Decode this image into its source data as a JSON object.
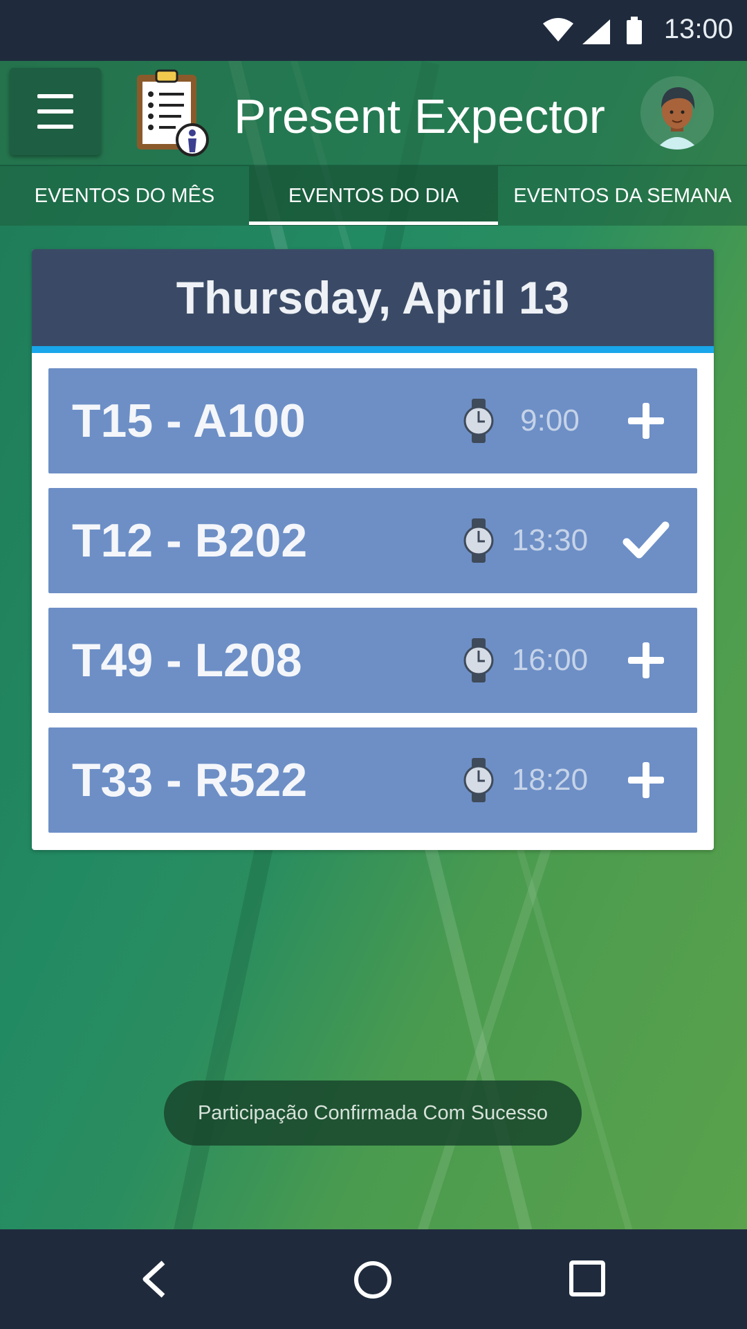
{
  "status_bar": {
    "time": "13:00",
    "icons": [
      "wifi-icon",
      "signal-icon",
      "battery-icon"
    ]
  },
  "app_bar": {
    "title": "Present Expector",
    "menu_icon": "hamburger-menu-icon",
    "logo_icon": "clipboard-checklist-icon",
    "avatar_icon": "user-avatar-icon"
  },
  "tabs": [
    {
      "label": "EVENTOS DO MÊS",
      "active": false
    },
    {
      "label": "EVENTOS DO DIA",
      "active": true
    },
    {
      "label": "EVENTOS DA SEMANA",
      "active": false
    }
  ],
  "day_card": {
    "date": "Thursday, April 13",
    "events": [
      {
        "name": "T15 - A100",
        "time": "9:00",
        "action_icon": "plus-icon"
      },
      {
        "name": "T12 - B202",
        "time": "13:30",
        "action_icon": "check-icon"
      },
      {
        "name": "T49 - L208",
        "time": "16:00",
        "action_icon": "plus-icon"
      },
      {
        "name": "T33 - R522",
        "time": "18:20",
        "action_icon": "plus-icon"
      }
    ]
  },
  "toast": {
    "message": "Participação Confirmada Com Sucesso"
  },
  "nav_bar": {
    "icons": [
      "back-icon",
      "home-icon",
      "recents-icon"
    ]
  },
  "colors": {
    "header": "#3a4a66",
    "accent": "#1aa6ea",
    "event_bg": "#6d8fc6",
    "system_bar": "#1f2b3d"
  }
}
